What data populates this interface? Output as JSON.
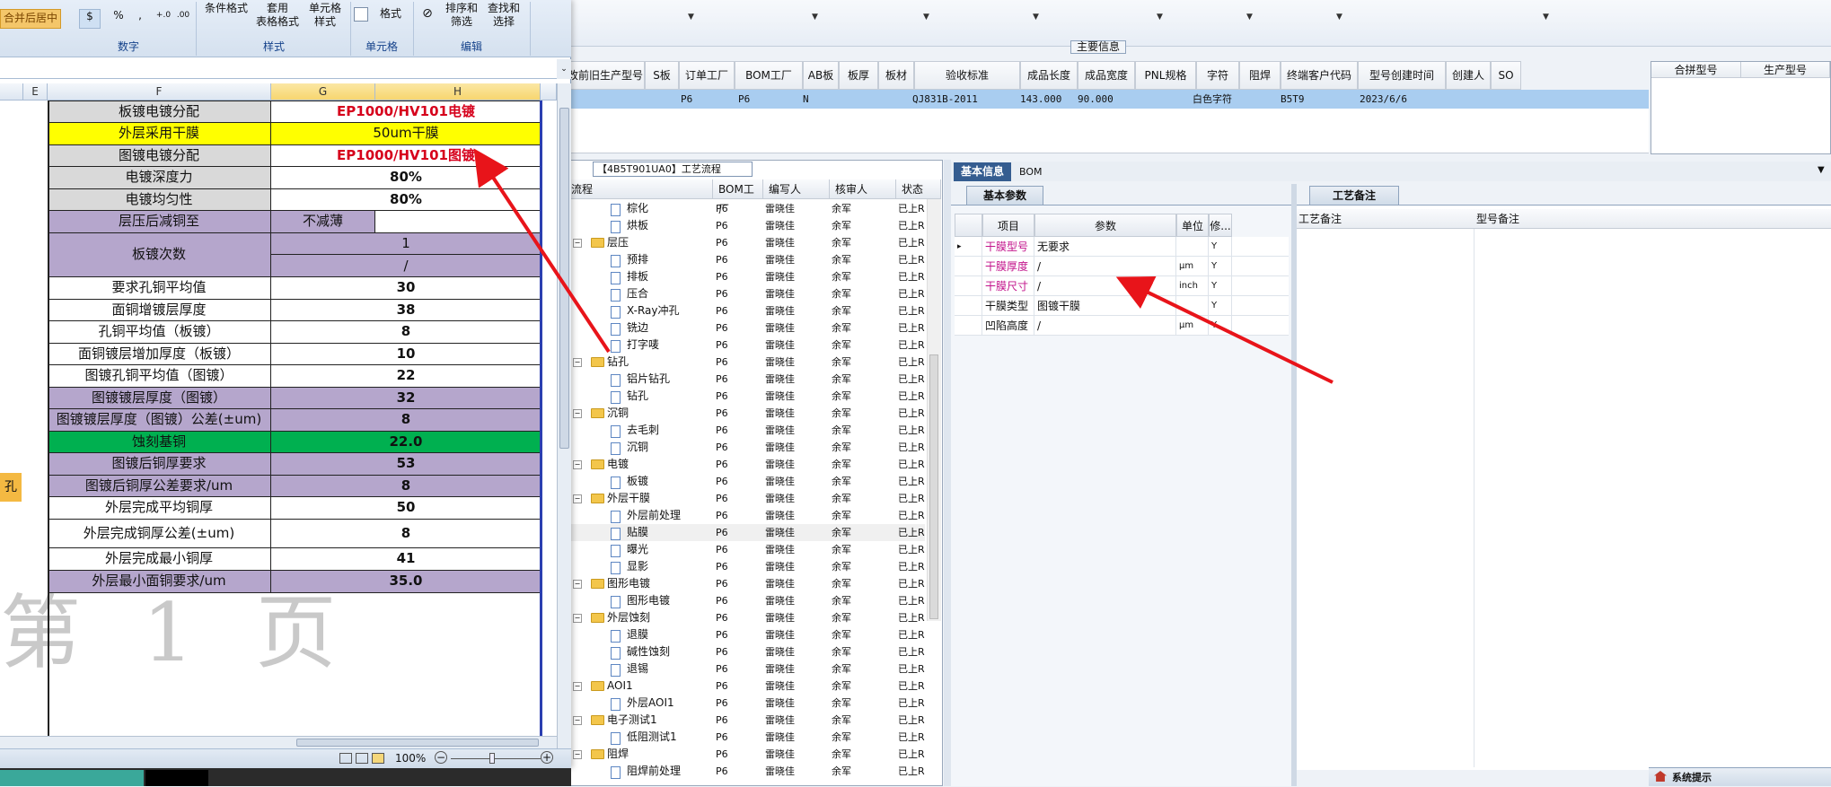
{
  "app": {
    "main_info_title": "主要信息",
    "grid_headers": [
      "改前旧生产型号",
      "S板",
      "订单工厂",
      "BOM工厂",
      "AB板",
      "板厚",
      "板材",
      "验收标准",
      "成品长度",
      "成品宽度",
      "PNL规格",
      "字符",
      "阻焊",
      "终端客户代码",
      "型号创建时间",
      "创建人",
      "SO"
    ],
    "grid_row": {
      "order_factory": "P6",
      "bom_factory": "P6",
      "ab_board": "N",
      "accept_std": "QJ831B-2011",
      "length": "143.000",
      "width": "90.000",
      "char": "白色字符",
      "customer_code": "B5T9",
      "created": "2023/6/6"
    },
    "side_headers": [
      "合拼型号",
      "生产型号"
    ],
    "process_title": "【4B5T901UA0】工艺流程",
    "process_headers": [
      "流程",
      "BOM工厂",
      "编写人",
      "核审人",
      "状态"
    ],
    "process_rows": [
      {
        "name": "棕化",
        "indent": 2,
        "type": "doc",
        "bom": "P6",
        "writer": "雷晓佳",
        "reviewer": "余军",
        "status": "已上R"
      },
      {
        "name": "烘板",
        "indent": 2,
        "type": "doc",
        "bom": "P6",
        "writer": "雷晓佳",
        "reviewer": "余军",
        "status": "已上R"
      },
      {
        "name": "层压",
        "indent": 1,
        "type": "folder",
        "bom": "P6",
        "writer": "雷晓佳",
        "reviewer": "余军",
        "status": "已上R"
      },
      {
        "name": "预排",
        "indent": 2,
        "type": "doc",
        "bom": "P6",
        "writer": "雷晓佳",
        "reviewer": "余军",
        "status": "已上R"
      },
      {
        "name": "排板",
        "indent": 2,
        "type": "doc",
        "bom": "P6",
        "writer": "雷晓佳",
        "reviewer": "余军",
        "status": "已上R"
      },
      {
        "name": "压合",
        "indent": 2,
        "type": "doc",
        "bom": "P6",
        "writer": "雷晓佳",
        "reviewer": "余军",
        "status": "已上R"
      },
      {
        "name": "X-Ray冲孔",
        "indent": 2,
        "type": "doc",
        "bom": "P6",
        "writer": "雷晓佳",
        "reviewer": "余军",
        "status": "已上R"
      },
      {
        "name": "铣边",
        "indent": 2,
        "type": "doc",
        "bom": "P6",
        "writer": "雷晓佳",
        "reviewer": "余军",
        "status": "已上R"
      },
      {
        "name": "打字唛",
        "indent": 2,
        "type": "doc",
        "bom": "P6",
        "writer": "雷晓佳",
        "reviewer": "余军",
        "status": "已上R"
      },
      {
        "name": "钻孔",
        "indent": 1,
        "type": "folder",
        "bom": "P6",
        "writer": "雷晓佳",
        "reviewer": "余军",
        "status": "已上R"
      },
      {
        "name": "铝片钻孔",
        "indent": 2,
        "type": "doc",
        "bom": "P6",
        "writer": "雷晓佳",
        "reviewer": "余军",
        "status": "已上R"
      },
      {
        "name": "钻孔",
        "indent": 2,
        "type": "doc",
        "bom": "P6",
        "writer": "雷晓佳",
        "reviewer": "余军",
        "status": "已上R"
      },
      {
        "name": "沉铜",
        "indent": 1,
        "type": "folder",
        "bom": "P6",
        "writer": "雷晓佳",
        "reviewer": "余军",
        "status": "已上R"
      },
      {
        "name": "去毛刺",
        "indent": 2,
        "type": "doc",
        "bom": "P6",
        "writer": "雷晓佳",
        "reviewer": "余军",
        "status": "已上R"
      },
      {
        "name": "沉铜",
        "indent": 2,
        "type": "doc",
        "bom": "P6",
        "writer": "雷晓佳",
        "reviewer": "余军",
        "status": "已上R"
      },
      {
        "name": "电镀",
        "indent": 1,
        "type": "folder",
        "bom": "P6",
        "writer": "雷晓佳",
        "reviewer": "余军",
        "status": "已上R"
      },
      {
        "name": "板镀",
        "indent": 2,
        "type": "doc",
        "bom": "P6",
        "writer": "雷晓佳",
        "reviewer": "余军",
        "status": "已上R"
      },
      {
        "name": "外层干膜",
        "indent": 1,
        "type": "folder",
        "bom": "P6",
        "writer": "雷晓佳",
        "reviewer": "余军",
        "status": "已上R"
      },
      {
        "name": "外层前处理",
        "indent": 2,
        "type": "doc",
        "bom": "P6",
        "writer": "雷晓佳",
        "reviewer": "余军",
        "status": "已上R"
      },
      {
        "name": "贴膜",
        "indent": 2,
        "type": "doc",
        "bom": "P6",
        "writer": "雷晓佳",
        "reviewer": "余军",
        "status": "已上R",
        "selected": true
      },
      {
        "name": "曝光",
        "indent": 2,
        "type": "doc",
        "bom": "P6",
        "writer": "雷晓佳",
        "reviewer": "余军",
        "status": "已上R"
      },
      {
        "name": "显影",
        "indent": 2,
        "type": "doc",
        "bom": "P6",
        "writer": "雷晓佳",
        "reviewer": "余军",
        "status": "已上R"
      },
      {
        "name": "图形电镀",
        "indent": 1,
        "type": "folder",
        "bom": "P6",
        "writer": "雷晓佳",
        "reviewer": "余军",
        "status": "已上R"
      },
      {
        "name": "图形电镀",
        "indent": 2,
        "type": "doc",
        "bom": "P6",
        "writer": "雷晓佳",
        "reviewer": "余军",
        "status": "已上R"
      },
      {
        "name": "外层蚀刻",
        "indent": 1,
        "type": "folder",
        "bom": "P6",
        "writer": "雷晓佳",
        "reviewer": "余军",
        "status": "已上R"
      },
      {
        "name": "退膜",
        "indent": 2,
        "type": "doc",
        "bom": "P6",
        "writer": "雷晓佳",
        "reviewer": "余军",
        "status": "已上R"
      },
      {
        "name": "碱性蚀刻",
        "indent": 2,
        "type": "doc",
        "bom": "P6",
        "writer": "雷晓佳",
        "reviewer": "余军",
        "status": "已上R"
      },
      {
        "name": "退锡",
        "indent": 2,
        "type": "doc",
        "bom": "P6",
        "writer": "雷晓佳",
        "reviewer": "余军",
        "status": "已上R"
      },
      {
        "name": "AOI1",
        "indent": 1,
        "type": "folder",
        "bom": "P6",
        "writer": "雷晓佳",
        "reviewer": "余军",
        "status": "已上R"
      },
      {
        "name": "外层AOI1",
        "indent": 2,
        "type": "doc",
        "bom": "P6",
        "writer": "雷晓佳",
        "reviewer": "余军",
        "status": "已上R"
      },
      {
        "name": "电子测试1",
        "indent": 1,
        "type": "folder",
        "bom": "P6",
        "writer": "雷晓佳",
        "reviewer": "余军",
        "status": "已上R"
      },
      {
        "name": "低阻测试1",
        "indent": 2,
        "type": "doc",
        "bom": "P6",
        "writer": "雷晓佳",
        "reviewer": "余军",
        "status": "已上R"
      },
      {
        "name": "阻焊",
        "indent": 1,
        "type": "folder",
        "bom": "P6",
        "writer": "雷晓佳",
        "reviewer": "余军",
        "status": "已上R"
      },
      {
        "name": "阻焊前处理",
        "indent": 2,
        "type": "doc",
        "bom": "P6",
        "writer": "雷晓佳",
        "reviewer": "余军",
        "status": "已上R"
      }
    ],
    "tabs": [
      "基本信息",
      "BOM"
    ],
    "basic_params_tab": "基本参数",
    "param_headers": [
      "项目",
      "参数",
      "单位",
      "修..."
    ],
    "param_rows": [
      {
        "item": "干膜型号",
        "value": "无要求",
        "unit": "",
        "flag": "Y",
        "pink": true
      },
      {
        "item": "干膜厚度",
        "value": "/",
        "unit": "μm",
        "flag": "Y",
        "pink": true
      },
      {
        "item": "干膜尺寸",
        "value": "/",
        "unit": "inch",
        "flag": "Y",
        "pink": true
      },
      {
        "item": "干膜类型",
        "value": "图镀干膜",
        "unit": "",
        "flag": "Y",
        "pink": false
      },
      {
        "item": "凹陷高度",
        "value": "/",
        "unit": "μm",
        "flag": "Y",
        "pink": false
      }
    ],
    "remark_tab": "工艺备注",
    "remark_headers": [
      "工艺备注",
      "型号备注"
    ],
    "system_tip": "系统提示"
  },
  "excel": {
    "ribbon": {
      "merge_center": "合并后居中",
      "percent": "%",
      "cond_format": "条件格式",
      "apply_table_format": "套用\n表格格式",
      "cell_style": "单元格\n样式",
      "format": "格式",
      "sort_filter": "排序和\n筛选",
      "find_select": "查找和\n选择",
      "groups": [
        "数字",
        "样式",
        "单元格",
        "编辑"
      ]
    },
    "columns": [
      "E",
      "F",
      "G",
      "H"
    ],
    "rows": [
      {
        "label": "板镀电镀分配",
        "value": "EP1000/HV101电镀",
        "label_bg": "gray",
        "value_bg": "white",
        "value_red": true
      },
      {
        "label": "外层采用干膜",
        "value": "50um干膜",
        "label_bg": "yellow",
        "value_bg": "yellow",
        "value_red": false,
        "value_normal": true
      },
      {
        "label": "图镀电镀分配",
        "value": "EP1000/HV101图镀",
        "label_bg": "gray",
        "value_bg": "white",
        "value_red": true
      },
      {
        "label": "电镀深度力",
        "value": "80%",
        "label_bg": "gray",
        "value_bg": "white"
      },
      {
        "label": "电镀均匀性",
        "value": "80%",
        "label_bg": "gray",
        "value_bg": "white"
      },
      {
        "label": "层压后减铜至",
        "value": "不减薄",
        "label_bg": "lilac",
        "value_bg": "split"
      },
      {
        "label": "板镀次数",
        "value": "1",
        "value2": "/",
        "label_bg": "lilac",
        "value_bg": "lilac",
        "double": true
      },
      {
        "label": "要求孔铜平均值",
        "value": "30",
        "label_bg": "white",
        "value_bg": "white"
      },
      {
        "label": "面铜增镀层厚度",
        "value": "38",
        "label_bg": "white",
        "value_bg": "white"
      },
      {
        "label": "孔铜平均值（板镀）",
        "value": "8",
        "label_bg": "white",
        "value_bg": "white"
      },
      {
        "label": "面铜镀层增加厚度（板镀）",
        "value": "10",
        "label_bg": "white",
        "value_bg": "white"
      },
      {
        "label": "图镀孔铜平均值（图镀）",
        "value": "22",
        "label_bg": "white",
        "value_bg": "white"
      },
      {
        "label": "图镀镀层厚度（图镀）",
        "value": "32",
        "label_bg": "lilac",
        "value_bg": "lilac"
      },
      {
        "label": "图镀镀层厚度（图镀）公差(±um)",
        "value": "8",
        "label_bg": "lilac",
        "value_bg": "lilac"
      },
      {
        "label": "蚀刻基铜",
        "value": "22.0",
        "label_bg": "green",
        "value_bg": "green"
      },
      {
        "label": "图镀后铜厚要求",
        "value": "53",
        "label_bg": "lilac",
        "value_bg": "lilac"
      },
      {
        "label": "图镀后铜厚公差要求/um",
        "value": "8",
        "label_bg": "lilac",
        "value_bg": "lilac"
      },
      {
        "label": "外层完成平均铜厚",
        "value": "50",
        "label_bg": "white",
        "value_bg": "white"
      },
      {
        "label": "外层完成铜厚公差(±um)",
        "value": "8",
        "label_bg": "white",
        "value_bg": "white"
      },
      {
        "label": "外层完成最小铜厚",
        "value": "41",
        "label_bg": "white",
        "value_bg": "white"
      },
      {
        "label": "外层最小面铜要求/um",
        "value": "35.0",
        "label_bg": "lilac",
        "value_bg": "lilac"
      }
    ],
    "left_fragment": "孔",
    "page_watermark": "第 1 页",
    "zoom": "100%"
  }
}
